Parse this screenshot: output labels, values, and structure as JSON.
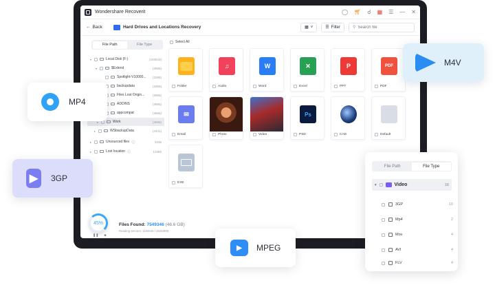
{
  "app": {
    "title": "Wondershare Recoverit"
  },
  "titlebar_icons": [
    "user-icon",
    "cart-icon",
    "headset-icon",
    "gift-icon",
    "menu-icon",
    "minimize-icon",
    "close-icon"
  ],
  "navbar": {
    "back_label": "Back",
    "location_title": "Hard Drives and Locations Recovery",
    "filter_label": "Filter",
    "search_placeholder": "Search file"
  },
  "tree": {
    "tabs": [
      "File Path",
      "File Type"
    ],
    "rows": [
      {
        "label": "Local Disk (F:)",
        "count": "(193543)"
      },
      {
        "label": "$Extend",
        "count": "(3565)"
      },
      {
        "label": "Spotlight-V10000...",
        "count": "(2265)"
      },
      {
        "label": "backupdata",
        "count": "(3265)"
      },
      {
        "label": "Files Lost Origin...",
        "count": "(2565)"
      },
      {
        "label": "ADDINS",
        "count": "(3565)"
      },
      {
        "label": "appcompat",
        "count": "(3565)"
      },
      {
        "label": "Work",
        "count": "(3565)"
      },
      {
        "label": "WSbackupData",
        "count": "(4431)"
      },
      {
        "label": "Unsourced files",
        "count": "3435"
      },
      {
        "label": "Lost location",
        "count": "13455"
      }
    ]
  },
  "grid": {
    "select_all": "Select All",
    "tiles": [
      "Folder",
      "Audio",
      "Word",
      "Excel",
      "PPT",
      "PDF",
      "Email",
      "Photo",
      "Video",
      "PSD",
      "CAD",
      "Default",
      "EXE"
    ]
  },
  "status": {
    "progress": "45%",
    "files_found_label": "Files Found:",
    "files_found_count": "7549346",
    "size": "(46.6 GB)",
    "reading": "Reading Sectors: 1100045 / 2545/999"
  },
  "cards": {
    "m4v": "M4V",
    "mp4": "MP4",
    "3gp": "3GP",
    "mpeg": "MPEG"
  },
  "filter_panel": {
    "tabs": [
      "File Path",
      "File Type"
    ],
    "video_label": "Video",
    "video_count": "16",
    "rows": [
      {
        "label": "3GP",
        "count": "10"
      },
      {
        "label": "Mp4",
        "count": "2"
      },
      {
        "label": "Mov",
        "count": "4"
      },
      {
        "label": "AVI",
        "count": "4"
      },
      {
        "label": "FLV",
        "count": "4"
      }
    ]
  },
  "colors": {
    "accent": "#2f8ff0",
    "brand_dark": "#1c1d22"
  }
}
